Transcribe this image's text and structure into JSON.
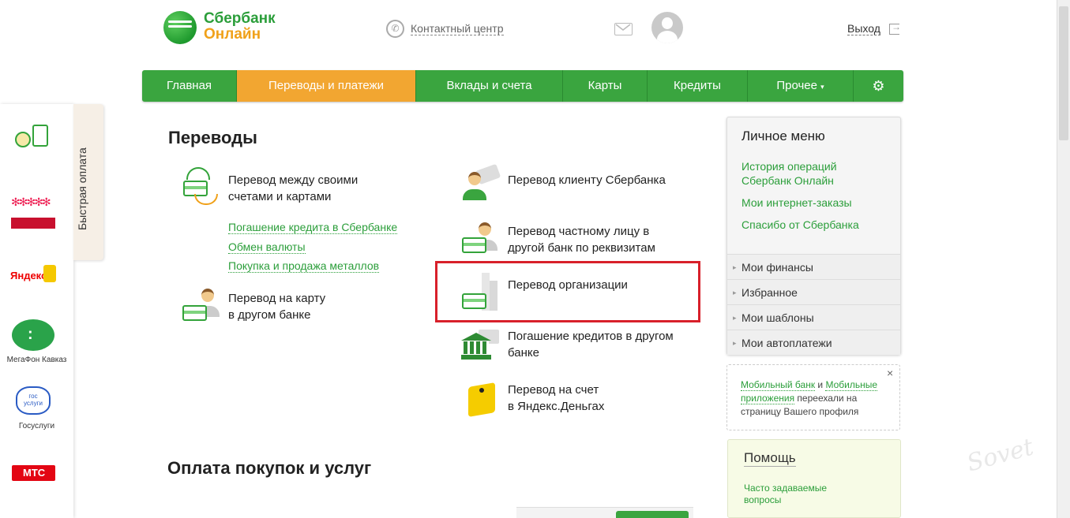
{
  "header": {
    "logo_line1": "Сбербанк",
    "logo_line2": "Онлайн",
    "contact_center": "Контактный центр",
    "logout": "Выход"
  },
  "nav": {
    "items": [
      "Главная",
      "Переводы и платежи",
      "Вклады и счета",
      "Карты",
      "Кредиты",
      "Прочее"
    ],
    "prochee_arrow": "▾",
    "settings_icon": "gear-icon",
    "active_index": 1
  },
  "quick_pay": {
    "tab_label": "Быстрая оплата",
    "items": [
      {
        "label": "",
        "icon": "phone-coin-icon"
      },
      {
        "label": "",
        "icon": "charity-icon"
      },
      {
        "label": "",
        "icon": "yandex-icon"
      },
      {
        "label": "МегаФон Кавказ",
        "icon": "megafon-icon"
      },
      {
        "label": "Госуслуги",
        "icon": "gosuslugi-icon"
      },
      {
        "label": "",
        "icon": "mts-icon"
      }
    ],
    "logo_texts": {
      "yandex": "Яндекс",
      "gosuslugi": "гос услуги",
      "mts": "МТС"
    }
  },
  "transfers": {
    "heading": "Переводы",
    "left": [
      {
        "line1": "Перевод между своими",
        "line2": "счетами и картами"
      },
      {
        "line1": "Перевод на карту",
        "line2": "в другом банке"
      }
    ],
    "sublinks": [
      "Погашение кредита в Сбербанке",
      "Обмен валюты",
      "Покупка и продажа металлов"
    ],
    "right": [
      {
        "line1": "Перевод клиенту Сбербанка",
        "line2": ""
      },
      {
        "line1": "Перевод частному лицу в",
        "line2": "другой банк по реквизитам"
      },
      {
        "line1": "Перевод организации",
        "line2": ""
      },
      {
        "line1": "Погашение кредитов в другом",
        "line2": "банке"
      },
      {
        "line1": "Перевод на счет",
        "line2": "в Яндекс.Деньгах"
      }
    ]
  },
  "payments": {
    "heading": "Оплата покупок и услуг"
  },
  "personal_menu": {
    "title": "Личное меню",
    "links": [
      "История операций Сбербанк Онлайн",
      "Мои интернет-заказы",
      "Спасибо от Сбербанка"
    ],
    "items": [
      "Мои финансы",
      "Избранное",
      "Мои шаблоны",
      "Мои автоплатежи"
    ]
  },
  "notice": {
    "link1": "Мобильный банк",
    "and": " и ",
    "link2": "Мобильные приложения",
    "rest": " переехали на страницу Вашего профиля",
    "close": "×"
  },
  "help": {
    "title": "Помощь",
    "faq": "Часто задаваемые вопросы"
  },
  "watermark": "Sovet",
  "colors": {
    "green": "#3aa53f",
    "orange": "#f2a631",
    "highlight": "#d8202a"
  }
}
